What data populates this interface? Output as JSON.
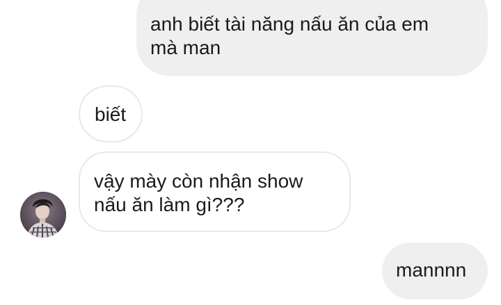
{
  "conversation": {
    "messages": [
      {
        "sender": "me",
        "text": "anh biết tài năng nấu ăn của em\nmà man"
      },
      {
        "sender": "other",
        "text": "biết"
      },
      {
        "sender": "other",
        "text": "vậy mày còn nhận show\nnấu ăn làm gì???"
      },
      {
        "sender": "me",
        "text": "mannnn"
      }
    ]
  },
  "colors": {
    "sent_bubble": "#efefef",
    "received_bubble_border": "#e8e8e8",
    "text": "#1a1a1a",
    "background": "#ffffff"
  },
  "icons": {
    "avatar": "contact-avatar-photo"
  }
}
